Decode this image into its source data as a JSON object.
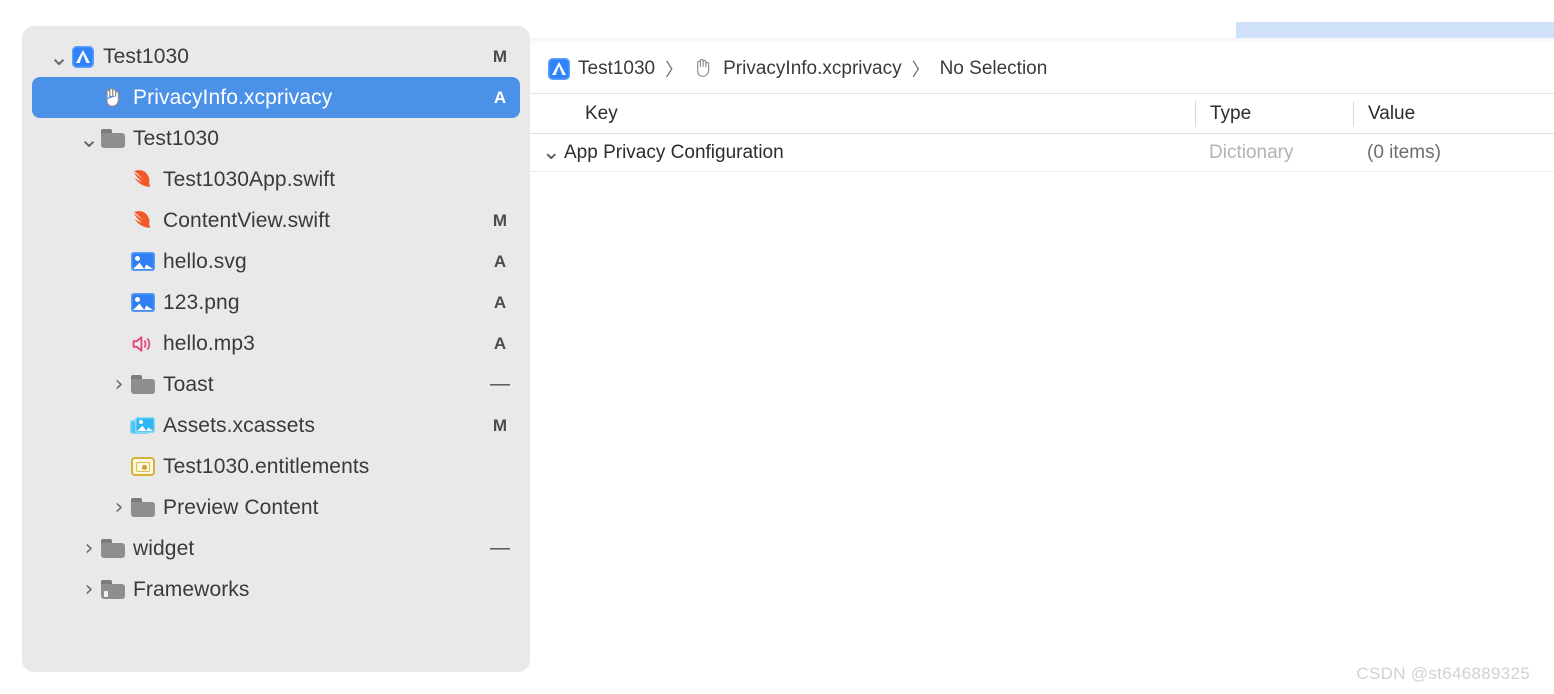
{
  "colors": {
    "selection_blue": "#4c91e8",
    "sidebar_bg": "#e9e9e9",
    "editor_bg": "#ffffff",
    "top_strip_blue": "#cfe0f9",
    "swift_orange": "#f05a28",
    "image_blue": "#2f7ff0",
    "speaker_pink": "#e8407f",
    "assets_cyan": "#2fb5f0",
    "entitlement_gold": "#d3b23a"
  },
  "navigator": {
    "items": [
      {
        "label": "Test1030",
        "icon": "app-store-icon",
        "twisty": "down",
        "indent": 0,
        "status": "M",
        "selected": false
      },
      {
        "label": "PrivacyInfo.xcprivacy",
        "icon": "hand-icon",
        "twisty": "none",
        "indent": 1,
        "status": "A",
        "selected": true
      },
      {
        "label": "Test1030",
        "icon": "folder-icon",
        "twisty": "down",
        "indent": 1,
        "status": "",
        "selected": false
      },
      {
        "label": "Test1030App.swift",
        "icon": "swift-icon",
        "twisty": "none",
        "indent": 2,
        "status": "",
        "selected": false
      },
      {
        "label": "ContentView.swift",
        "icon": "swift-icon",
        "twisty": "none",
        "indent": 2,
        "status": "M",
        "selected": false
      },
      {
        "label": "hello.svg",
        "icon": "image-icon",
        "twisty": "none",
        "indent": 2,
        "status": "A",
        "selected": false
      },
      {
        "label": "123.png",
        "icon": "image-icon",
        "twisty": "none",
        "indent": 2,
        "status": "A",
        "selected": false
      },
      {
        "label": "hello.mp3",
        "icon": "speaker-icon",
        "twisty": "none",
        "indent": 2,
        "status": "A",
        "selected": false
      },
      {
        "label": "Toast",
        "icon": "folder-icon",
        "twisty": "right",
        "indent": 2,
        "status": "—",
        "selected": false
      },
      {
        "label": "Assets.xcassets",
        "icon": "assets-icon",
        "twisty": "none",
        "indent": 2,
        "status": "M",
        "selected": false
      },
      {
        "label": "Test1030.entitlements",
        "icon": "entitlement-icon",
        "twisty": "none",
        "indent": 2,
        "status": "",
        "selected": false
      },
      {
        "label": "Preview Content",
        "icon": "folder-icon",
        "twisty": "right",
        "indent": 2,
        "status": "",
        "selected": false
      },
      {
        "label": "widget",
        "icon": "folder-icon",
        "twisty": "right",
        "indent": 1,
        "status": "—",
        "selected": false
      },
      {
        "label": "Frameworks",
        "icon": "folder-library-icon",
        "twisty": "right",
        "indent": 1,
        "status": "",
        "selected": false
      }
    ]
  },
  "editor": {
    "breadcrumb": {
      "separator": "〉",
      "items": [
        {
          "label": "Test1030",
          "icon": "app-store-icon"
        },
        {
          "label": "PrivacyInfo.xcprivacy",
          "icon": "hand-icon"
        },
        {
          "label": "No Selection",
          "icon": "none"
        }
      ]
    },
    "table": {
      "headers": {
        "key": "Key",
        "type": "Type",
        "value": "Value"
      },
      "rows": [
        {
          "key": "App Privacy Configuration",
          "type": "Dictionary",
          "value": "(0 items)",
          "twisty": "down"
        }
      ]
    }
  },
  "watermark": {
    "text": "CSDN @st646889325"
  }
}
